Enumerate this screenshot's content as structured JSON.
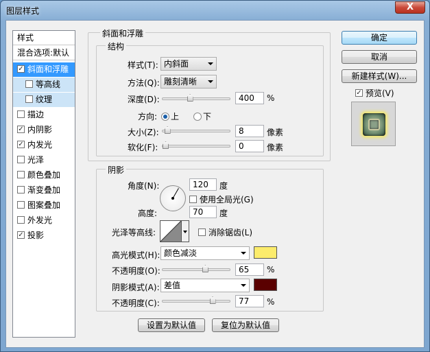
{
  "window": {
    "title": "图层样式",
    "close_glyph": "X"
  },
  "left": {
    "items": [
      {
        "label": "样式",
        "checkbox": false
      },
      {
        "label": "混合选项:默认",
        "checkbox": false
      },
      {
        "label": "斜面和浮雕",
        "checked": true
      },
      {
        "label": "等高线",
        "checked": false
      },
      {
        "label": "纹理",
        "checked": false
      },
      {
        "label": "描边",
        "checked": false
      },
      {
        "label": "内阴影",
        "checked": true
      },
      {
        "label": "内发光",
        "checked": true
      },
      {
        "label": "光泽",
        "checked": false
      },
      {
        "label": "颜色叠加",
        "checked": false
      },
      {
        "label": "渐变叠加",
        "checked": false
      },
      {
        "label": "图案叠加",
        "checked": false
      },
      {
        "label": "外发光",
        "checked": false
      },
      {
        "label": "投影",
        "checked": true
      }
    ],
    "check_glyph": "✓"
  },
  "bevel": {
    "group_title": "斜面和浮雕",
    "structure_title": "结构",
    "style_label": "样式(T):",
    "style_value": "内斜面",
    "technique_label": "方法(Q):",
    "technique_value": "雕刻清晰",
    "depth_label": "深度(D):",
    "depth_value": "400",
    "depth_unit": "%",
    "depth_level": 0.4,
    "direction_label": "方向:",
    "dir_up": "上",
    "dir_down": "下",
    "size_label": "大小(Z):",
    "size_value": "8",
    "size_unit": "像素",
    "size_level": 0.03,
    "soften_label": "软化(F):",
    "soften_value": "0",
    "soften_unit": "像素",
    "soften_level": 0.0
  },
  "shading": {
    "title": "阴影",
    "angle_label": "角度(N):",
    "angle_value": "120",
    "angle_unit": "度",
    "global_light_label": "使用全局光(G)",
    "altitude_label": "高度:",
    "altitude_value": "70",
    "altitude_unit": "度",
    "gloss_label": "光泽等高线:",
    "antialias_label": "消除锯齿(L)",
    "highlight_label": "高光模式(H):",
    "highlight_mode": "颜色减淡",
    "highlight_color": "#fcec6c",
    "hl_opacity_label": "不透明度(O):",
    "hl_opacity_value": "65",
    "hl_opacity_unit": "%",
    "hl_opacity_level": 0.65,
    "shadow_label": "阴影模式(A):",
    "shadow_mode": "差值",
    "shadow_color": "#5a0000",
    "sh_opacity_label": "不透明度(C):",
    "sh_opacity_value": "77",
    "sh_opacity_unit": "%",
    "sh_opacity_level": 0.77
  },
  "bottom": {
    "set_default": "设置为默认值",
    "reset_default": "复位为默认值"
  },
  "right": {
    "ok": "确定",
    "cancel": "取消",
    "new_style": "新建样式(W)...",
    "preview": "预览(V)"
  }
}
